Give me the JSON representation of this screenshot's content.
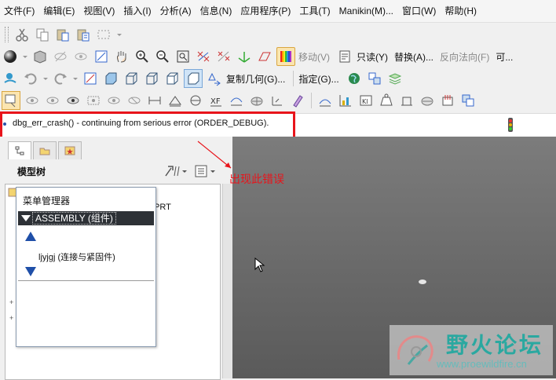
{
  "menubar": {
    "items": [
      "文件(F)",
      "编辑(E)",
      "视图(V)",
      "插入(I)",
      "分析(A)",
      "信息(N)",
      "应用程序(P)",
      "工具(T)",
      "Manikin(M)...",
      "窗口(W)",
      "帮助(H)"
    ]
  },
  "toolbar2": {
    "move_label": "移动(V)",
    "readonly_label": "只读(Y)",
    "replace_label": "替换(A)...",
    "reverse_label": "反向法向(F)",
    "more_label": "可..."
  },
  "toolbar3": {
    "copy_geom_label": "复制几何(G)...",
    "specify_label": "指定(G)..."
  },
  "message": {
    "text": "dbg_err_crash() - continuing from serious error (ORDER_DEBUG)."
  },
  "model_tree": {
    "title": "模型树",
    "prt_fragment": "PRT"
  },
  "menu_manager": {
    "title": "菜单管理器",
    "selected": "ASSEMBLY (组件)",
    "item": "ljyjgj (连接与紧固件)"
  },
  "annotation": {
    "text": "出现此错误",
    "color": "#e8141b"
  },
  "watermark": {
    "text": "野火论坛",
    "url": "www.proewildfire.cn"
  },
  "colors": {
    "error_border": "#e8141b",
    "menu_selection": "#2d3136"
  }
}
